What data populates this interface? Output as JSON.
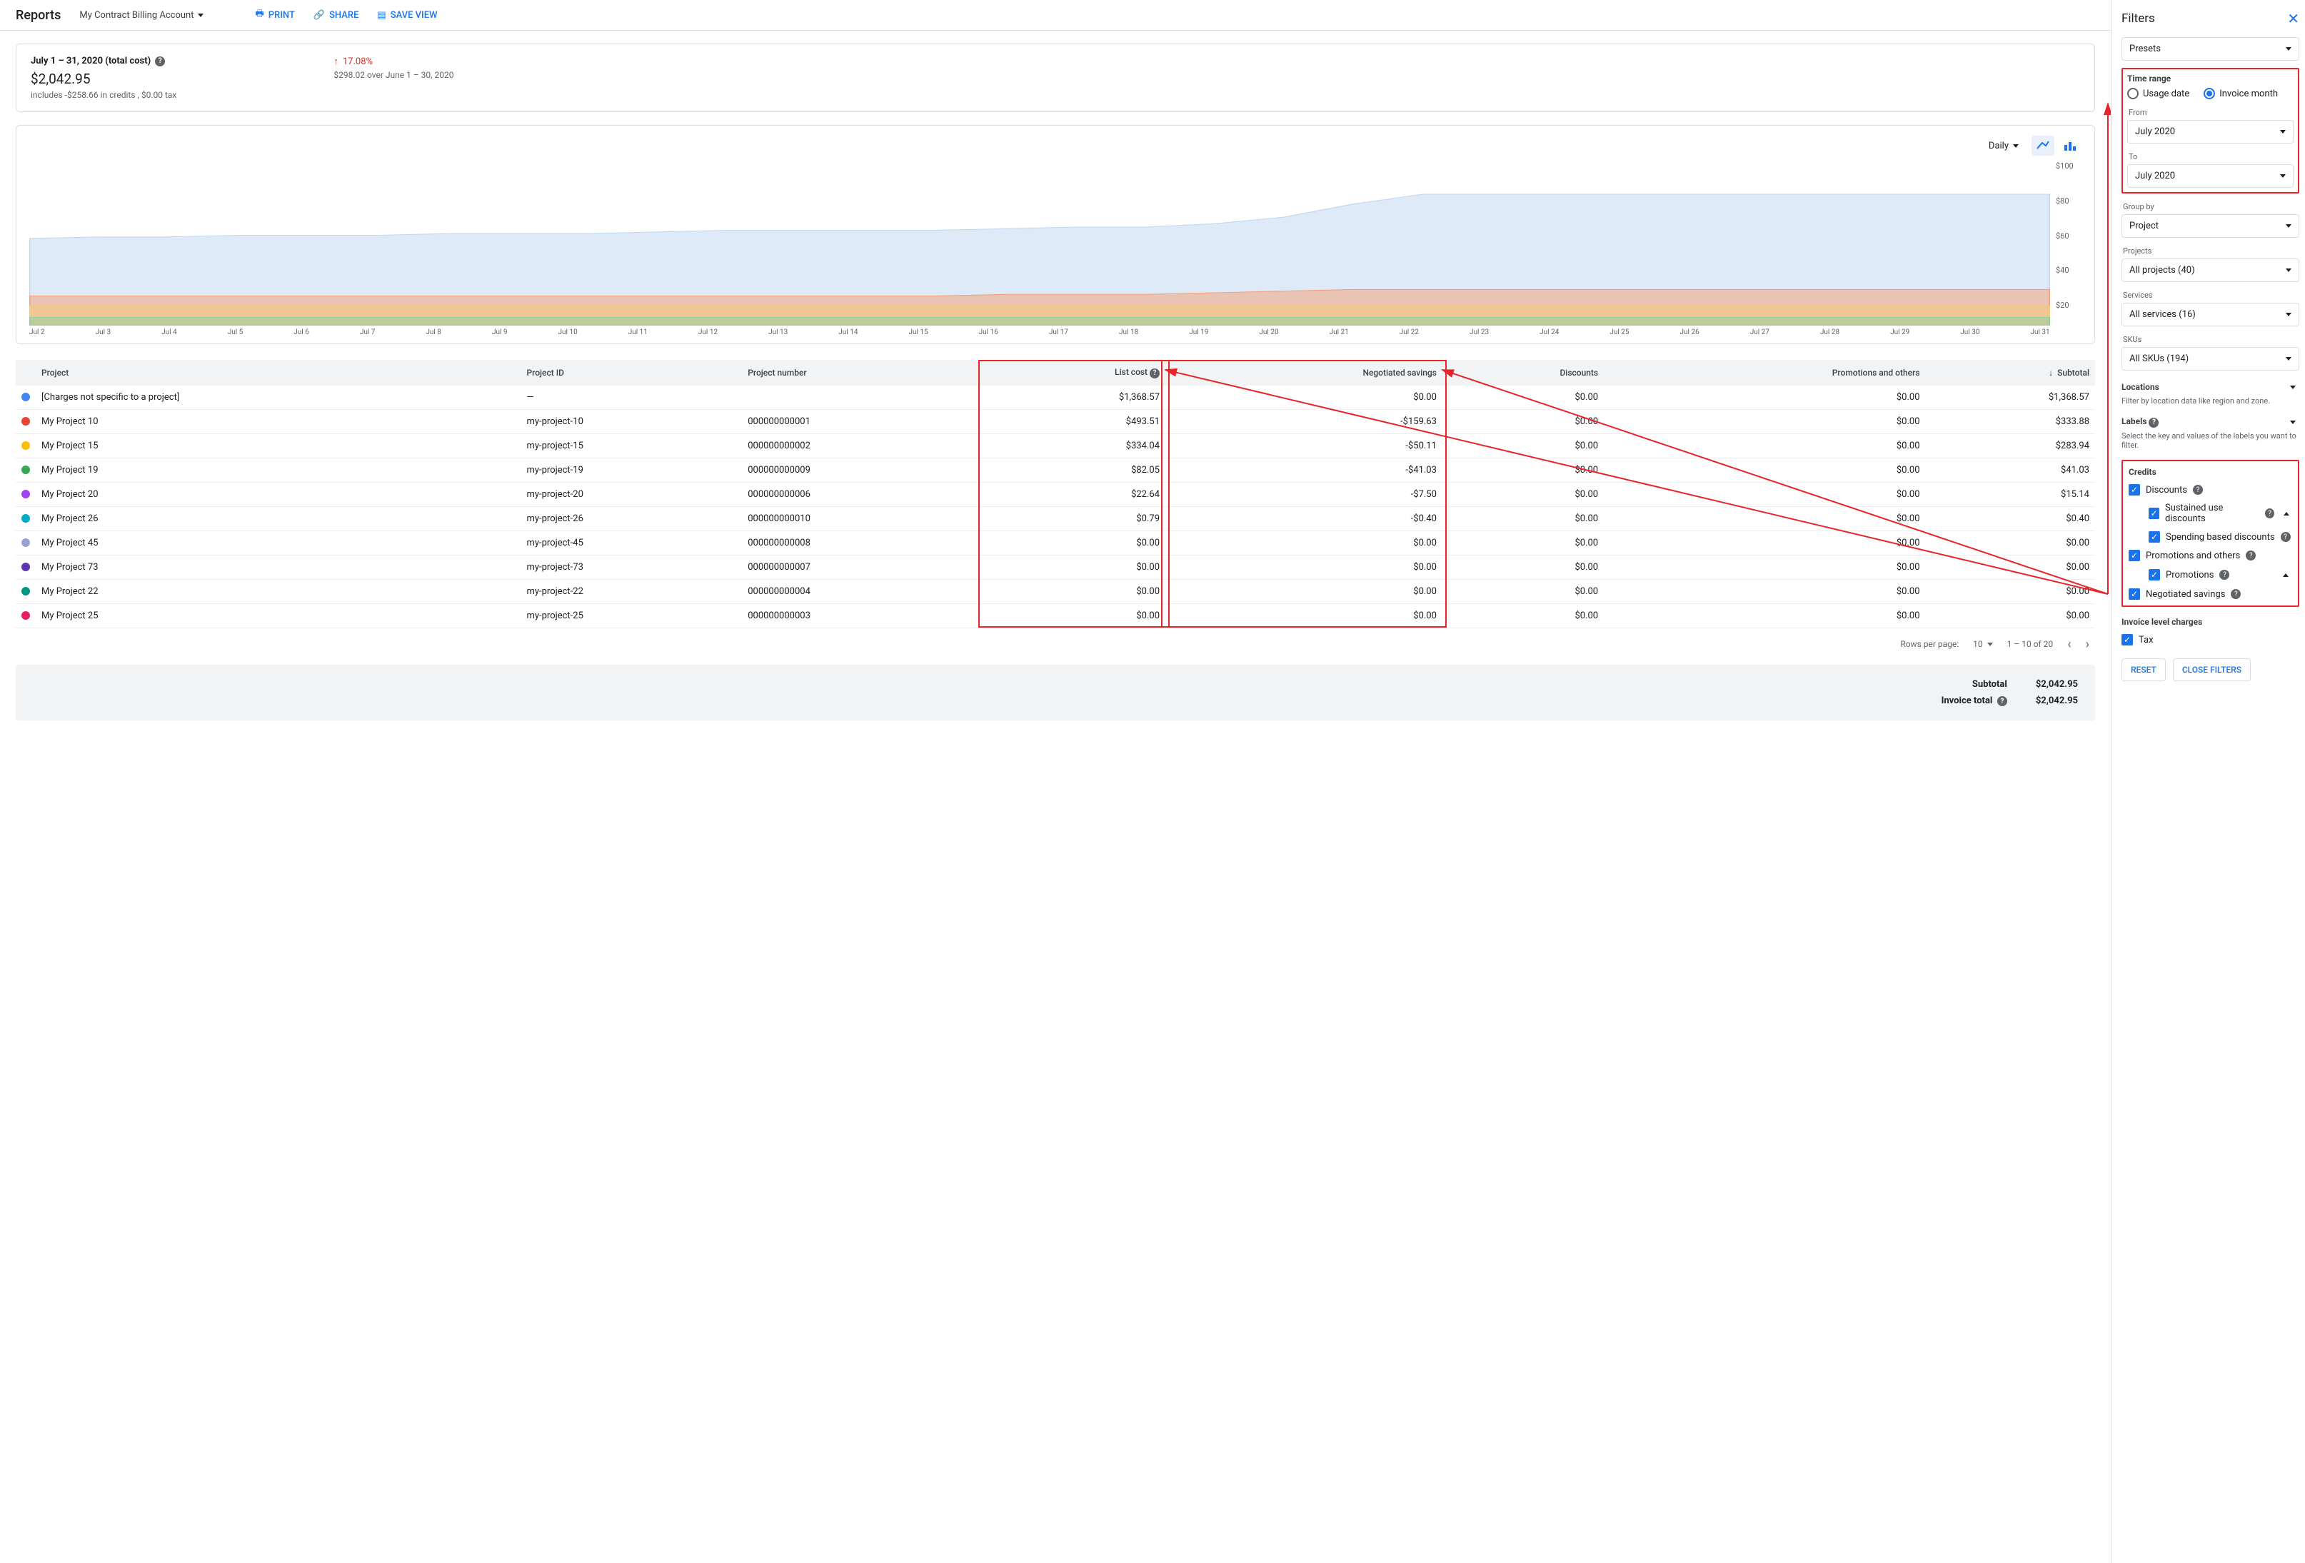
{
  "header": {
    "title": "Reports",
    "account": "My Contract Billing Account",
    "print": "PRINT",
    "share": "SHARE",
    "save": "SAVE VIEW"
  },
  "summary": {
    "range": "July 1 – 31, 2020 (total cost)",
    "total": "$2,042.95",
    "sub": "includes -$258.66 in credits , $0.00 tax",
    "pct": "17.08%",
    "over": "$298.02 over June 1 – 30, 2020"
  },
  "chart": {
    "gran": "Daily",
    "yticks": [
      "$100",
      "$80",
      "$60",
      "$40",
      "$20"
    ],
    "xticks": [
      "Jul 2",
      "Jul 3",
      "Jul 4",
      "Jul 5",
      "Jul 6",
      "Jul 7",
      "Jul 8",
      "Jul 9",
      "Jul 10",
      "Jul 11",
      "Jul 12",
      "Jul 13",
      "Jul 14",
      "Jul 15",
      "Jul 16",
      "Jul 17",
      "Jul 18",
      "Jul 19",
      "Jul 20",
      "Jul 21",
      "Jul 22",
      "Jul 23",
      "Jul 24",
      "Jul 25",
      "Jul 26",
      "Jul 27",
      "Jul 28",
      "Jul 29",
      "Jul 30",
      "Jul 31"
    ]
  },
  "chart_data": {
    "type": "area",
    "xlabel": "",
    "ylabel": "",
    "ylim": [
      0,
      100
    ],
    "categories": [
      "Jul 2",
      "Jul 3",
      "Jul 4",
      "Jul 5",
      "Jul 6",
      "Jul 7",
      "Jul 8",
      "Jul 9",
      "Jul 10",
      "Jul 11",
      "Jul 12",
      "Jul 13",
      "Jul 14",
      "Jul 15",
      "Jul 16",
      "Jul 17",
      "Jul 18",
      "Jul 19",
      "Jul 20",
      "Jul 21",
      "Jul 22",
      "Jul 23",
      "Jul 24",
      "Jul 25",
      "Jul 26",
      "Jul 27",
      "Jul 28",
      "Jul 29",
      "Jul 30",
      "Jul 31"
    ],
    "series": [
      {
        "name": "[Charges not specific to a project]",
        "color": "#c2d8f0",
        "values": [
          53,
          54,
          54,
          55,
          55,
          55,
          56,
          56,
          56,
          57,
          58,
          58,
          58,
          58,
          59,
          60,
          60,
          62,
          66,
          74,
          80,
          80,
          80,
          80,
          80,
          80,
          80,
          80,
          80,
          80
        ]
      },
      {
        "name": "My Project 10",
        "color": "#f2a27d",
        "values": [
          18,
          18,
          18,
          18,
          18,
          18,
          18,
          18,
          18,
          18,
          18,
          18,
          18,
          18,
          19,
          19,
          19,
          20,
          21,
          22,
          22,
          22,
          22,
          22,
          22,
          22,
          22,
          22,
          22,
          22
        ]
      },
      {
        "name": "My Project 15",
        "color": "#f5c97a",
        "values": [
          12,
          12,
          12,
          12,
          12,
          12,
          12,
          12,
          12,
          12,
          12,
          12,
          12,
          12,
          12,
          12,
          12,
          12,
          12,
          12,
          12,
          12,
          12,
          12,
          12,
          12,
          12,
          12,
          12,
          12
        ]
      },
      {
        "name": "My Project 19",
        "color": "#8fd19e",
        "values": [
          5,
          5,
          5,
          5,
          5,
          5,
          5,
          5,
          5,
          5,
          5,
          5,
          5,
          5,
          5,
          5,
          5,
          5,
          5,
          5,
          5,
          5,
          5,
          5,
          5,
          5,
          5,
          5,
          5,
          5
        ]
      }
    ]
  },
  "columns": {
    "project": "Project",
    "pid": "Project ID",
    "pnum": "Project number",
    "list": "List cost",
    "neg": "Negotiated savings",
    "disc": "Discounts",
    "promo": "Promotions and others",
    "sub": "Subtotal"
  },
  "rows": [
    {
      "c": "#4285f4",
      "name": "[Charges not specific to a project]",
      "id": "—",
      "num": "",
      "list": "$1,368.57",
      "neg": "$0.00",
      "disc": "$0.00",
      "promo": "$0.00",
      "sub": "$1,368.57"
    },
    {
      "c": "#ea4335",
      "name": "My Project 10",
      "id": "my-project-10",
      "num": "000000000001",
      "list": "$493.51",
      "neg": "-$159.63",
      "disc": "$0.00",
      "promo": "$0.00",
      "sub": "$333.88"
    },
    {
      "c": "#fbbc04",
      "name": "My Project 15",
      "id": "my-project-15",
      "num": "000000000002",
      "list": "$334.04",
      "neg": "-$50.11",
      "disc": "$0.00",
      "promo": "$0.00",
      "sub": "$283.94"
    },
    {
      "c": "#34a853",
      "name": "My Project 19",
      "id": "my-project-19",
      "num": "000000000009",
      "list": "$82.05",
      "neg": "-$41.03",
      "disc": "$0.00",
      "promo": "$0.00",
      "sub": "$41.03"
    },
    {
      "c": "#a142f4",
      "name": "My Project 20",
      "id": "my-project-20",
      "num": "000000000006",
      "list": "$22.64",
      "neg": "-$7.50",
      "disc": "$0.00",
      "promo": "$0.00",
      "sub": "$15.14"
    },
    {
      "c": "#00acc1",
      "name": "My Project 26",
      "id": "my-project-26",
      "num": "000000000010",
      "list": "$0.79",
      "neg": "-$0.40",
      "disc": "$0.00",
      "promo": "$0.00",
      "sub": "$0.40"
    },
    {
      "c": "#9aa0d6",
      "name": "My Project 45",
      "id": "my-project-45",
      "num": "000000000008",
      "list": "$0.00",
      "neg": "$0.00",
      "disc": "$0.00",
      "promo": "$0.00",
      "sub": "$0.00"
    },
    {
      "c": "#5e35b1",
      "name": "My Project 73",
      "id": "my-project-73",
      "num": "000000000007",
      "list": "$0.00",
      "neg": "$0.00",
      "disc": "$0.00",
      "promo": "$0.00",
      "sub": "$0.00"
    },
    {
      "c": "#009688",
      "name": "My Project 22",
      "id": "my-project-22",
      "num": "000000000004",
      "list": "$0.00",
      "neg": "$0.00",
      "disc": "$0.00",
      "promo": "$0.00",
      "sub": "$0.00"
    },
    {
      "c": "#e91e63",
      "name": "My Project 25",
      "id": "my-project-25",
      "num": "000000000003",
      "list": "$0.00",
      "neg": "$0.00",
      "disc": "$0.00",
      "promo": "$0.00",
      "sub": "$0.00"
    }
  ],
  "pager": {
    "rpp": "Rows per page:",
    "rpp_val": "10",
    "range": "1 – 10 of 20"
  },
  "totals": {
    "subtotal_l": "Subtotal",
    "subtotal_v": "$2,042.95",
    "invoice_l": "Invoice total",
    "invoice_v": "$2,042.95"
  },
  "filters": {
    "title": "Filters",
    "presets": "Presets",
    "time_h": "Time range",
    "usage": "Usage date",
    "invoice": "Invoice month",
    "from_l": "From",
    "from_v": "July 2020",
    "to_l": "To",
    "to_v": "July 2020",
    "group_l": "Group by",
    "group_v": "Project",
    "projects_l": "Projects",
    "projects_v": "All projects (40)",
    "services_l": "Services",
    "services_v": "All services (16)",
    "skus_l": "SKUs",
    "skus_v": "All SKUs (194)",
    "loc_l": "Locations",
    "loc_sub": "Filter by location data like region and zone.",
    "labels_l": "Labels",
    "labels_sub": "Select the key and values of the labels you want to filter.",
    "credits_h": "Credits",
    "discounts": "Discounts",
    "sustained": "Sustained use discounts",
    "spending": "Spending based discounts",
    "promos": "Promotions and others",
    "promotions": "Promotions",
    "negotiated": "Negotiated savings",
    "invlevel": "Invoice level charges",
    "tax": "Tax",
    "reset": "RESET",
    "close": "CLOSE FILTERS"
  }
}
